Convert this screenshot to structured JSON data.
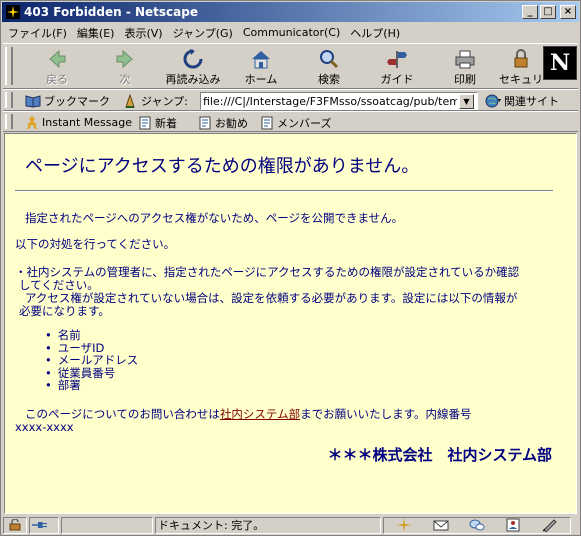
{
  "window": {
    "title": "403 Forbidden - Netscape",
    "minimize": "_",
    "maximize": "□",
    "close": "×"
  },
  "menu": [
    "ファイル(F)",
    "編集(E)",
    "表示(V)",
    "ジャンプ(G)",
    "Communicator(C)",
    "ヘルプ(H)"
  ],
  "nav": {
    "back": "戻る",
    "forward": "次",
    "reload": "再読み込み",
    "home": "ホーム",
    "search": "検索",
    "guide": "ガイド",
    "print": "印刷",
    "security": "セキュリ"
  },
  "logo": "N",
  "location": {
    "bookmarks": "ブックマーク",
    "jump_label": "ジャンプ:",
    "url": "file:///C|/Interstage/F3FMsso/ssoatcag/pub/tem",
    "related": "関連サイト"
  },
  "personal": {
    "instant_message": "Instant Message",
    "new": "新着",
    "recommend": "お勧め",
    "members": "メンバーズ"
  },
  "page": {
    "heading": "ページにアクセスするための権限がありません。",
    "line1": "指定されたページへのアクセス権がないため、ページを公開できません。",
    "line2": "以下の対処を行ってください。",
    "line3": "・社内システムの管理者に、指定されたページにアクセスするための権限が設定されているか確認",
    "line4": "してください。",
    "line5": "アクセス権が設定されていない場合は、設定を依頼する必要があります。設定には以下の情報が",
    "line6": "必要になります。",
    "items": [
      "名前",
      "ユーザID",
      "メールアドレス",
      "従業員番号",
      "部署"
    ],
    "contact_pre": "このページについてのお問い合わせは",
    "contact_link": "社内システム部",
    "contact_post": "までお願いいたします。内線番号",
    "ext": "xxxx-xxxx",
    "company": "＊＊＊株式会社　社内システム部"
  },
  "status": {
    "text": "ドキュメント: 完了。"
  },
  "colors": {
    "content_bg": "#ffffcc",
    "text": "#000080",
    "link": "#800000",
    "chrome": "#d4d0c8"
  }
}
